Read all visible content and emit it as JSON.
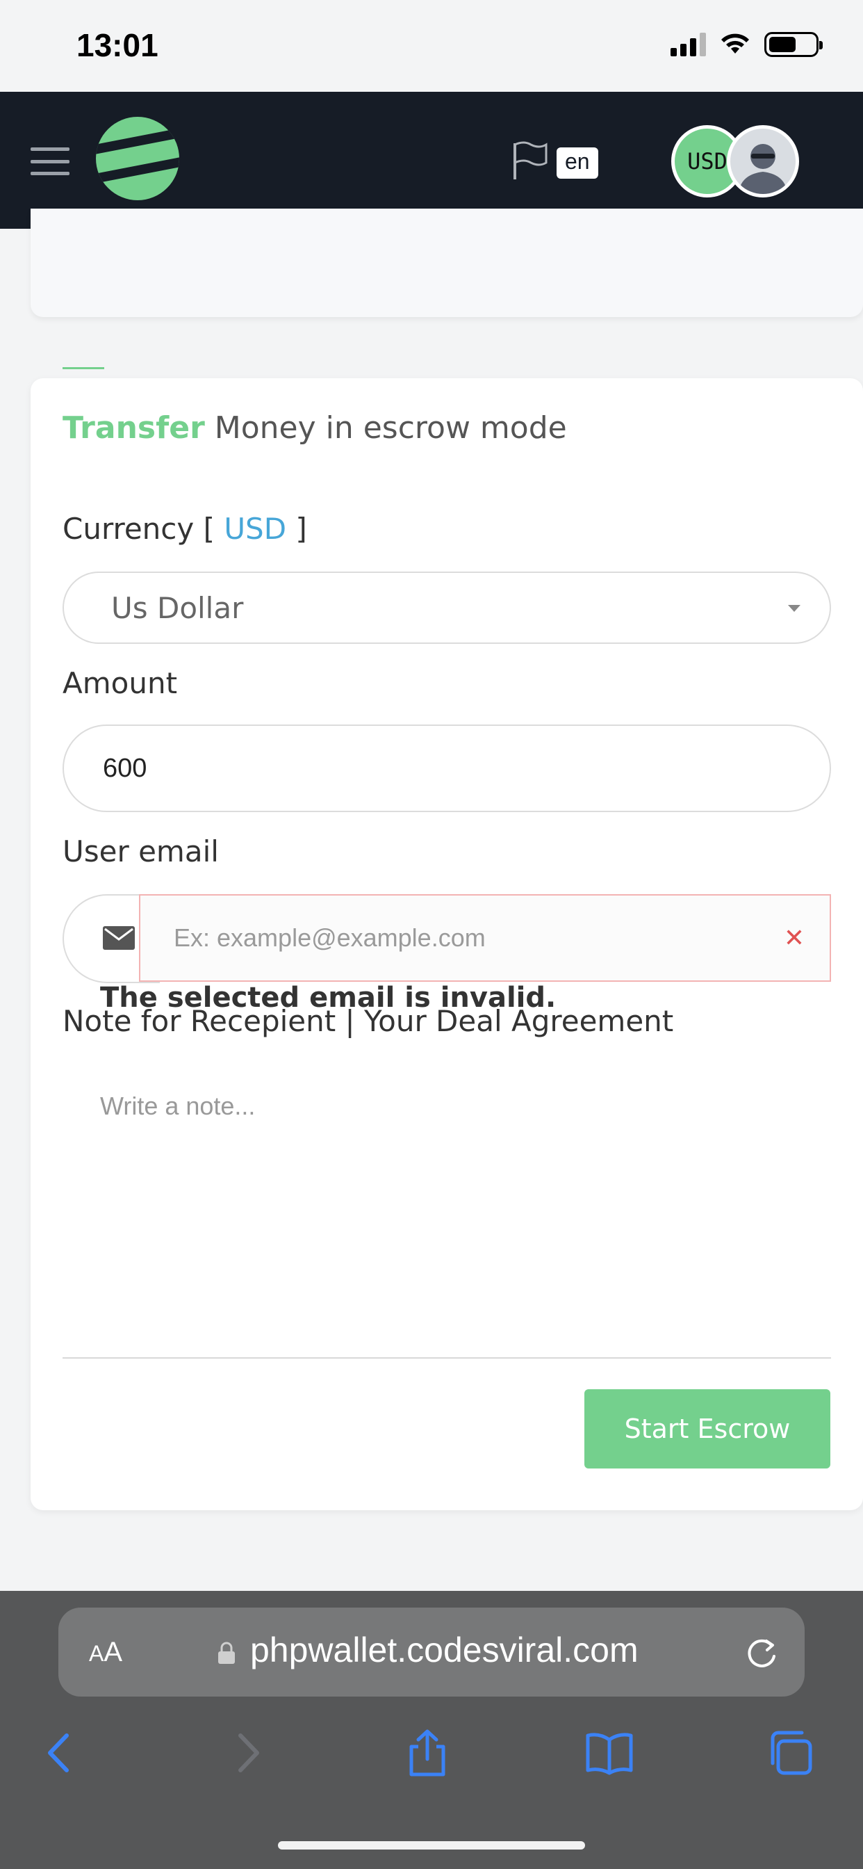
{
  "status_bar": {
    "time": "13:01"
  },
  "navbar": {
    "language": "en",
    "currency_badge": "USD"
  },
  "form": {
    "title_highlight": "Transfer",
    "title_rest": " Money in escrow mode",
    "currency_label": "Currency [ ",
    "currency_code": "USD",
    "currency_label_end": " ]",
    "currency_selected": "Us Dollar",
    "amount_label": "Amount",
    "amount_value": "600",
    "email_label": "User email",
    "email_placeholder": "Ex: example@example.com",
    "email_error": "The selected email is invalid.",
    "note_label": "Note for Recepient | Your Deal Agreement",
    "note_placeholder": "Write a note...",
    "submit_label": "Start Escrow"
  },
  "browser": {
    "aa_label_small": "A",
    "aa_label": "A",
    "url": "phpwallet.codesviral.com"
  },
  "colors": {
    "brand_green": "#74d08d",
    "navbar_bg": "#161c26",
    "link_blue": "#47a6d8",
    "error_red": "#e05252",
    "ios_blue": "#3b82f6"
  }
}
